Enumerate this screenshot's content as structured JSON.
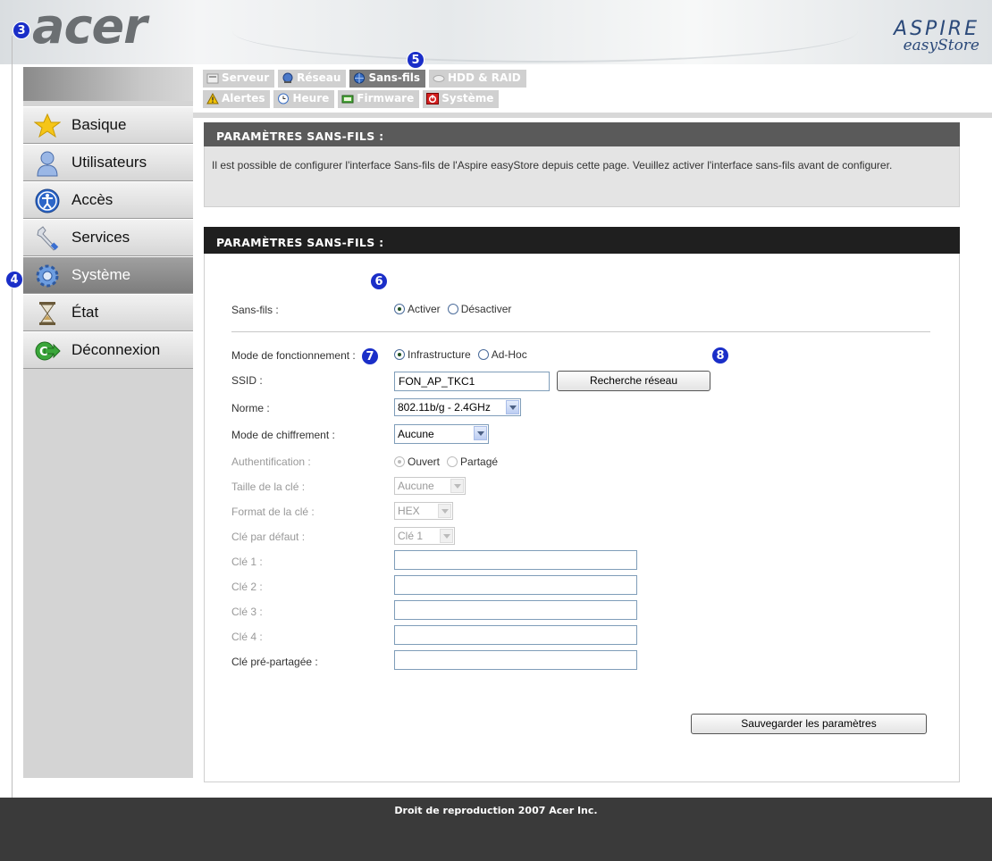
{
  "header": {
    "logo": "acer",
    "brand_line1": "ASPIRE",
    "brand_line2": "easyStore"
  },
  "badges": {
    "b3": "3",
    "b4": "4",
    "b5": "5",
    "b6": "6",
    "b7": "7",
    "b8": "8"
  },
  "sidebar": {
    "items": [
      {
        "label": "Basique",
        "icon": "star-icon"
      },
      {
        "label": "Utilisateurs",
        "icon": "user-icon"
      },
      {
        "label": "Accès",
        "icon": "accessibility-icon"
      },
      {
        "label": "Services",
        "icon": "wrench-icon"
      },
      {
        "label": "Système",
        "icon": "gear-icon",
        "active": true
      },
      {
        "label": "État",
        "icon": "hourglass-icon"
      },
      {
        "label": "Déconnexion",
        "icon": "logout-icon"
      }
    ]
  },
  "tabs": {
    "row1": [
      "Serveur",
      "Réseau",
      "Sans-fils",
      "HDD & RAID"
    ],
    "row2": [
      "Alertes",
      "Heure",
      "Firmware",
      "Système"
    ],
    "active": "Sans-fils"
  },
  "intro": {
    "title": "PARAMÈTRES SANS-FILS :",
    "text": "Il est possible de configurer l'interface Sans-fils de l'Aspire easyStore depuis cette page. Veuillez activer l'interface sans-fils avant de configurer."
  },
  "form": {
    "title": "PARAMÈTRES SANS-FILS :",
    "wireless_label": "Sans-fils :",
    "wireless_on": "Activer",
    "wireless_off": "Désactiver",
    "mode_label": "Mode de fonctionnement :",
    "mode_infra": "Infrastructure",
    "mode_adhoc": "Ad-Hoc",
    "ssid_label": "SSID :",
    "ssid_value": "FON_AP_TKC1",
    "scan_button": "Recherche réseau",
    "norm_label": "Norme :",
    "norm_value": "802.11b/g - 2.4GHz",
    "encryption_label": "Mode de chiffrement :",
    "encryption_value": "Aucune",
    "auth_label": "Authentification :",
    "auth_open": "Ouvert",
    "auth_shared": "Partagé",
    "keysize_label": "Taille de la clé :",
    "keysize_value": "Aucune",
    "keyformat_label": "Format de la clé :",
    "keyformat_value": "HEX",
    "defaultkey_label": "Clé par défaut :",
    "defaultkey_value": "Clé 1",
    "key1_label": "Clé 1 :",
    "key2_label": "Clé 2 :",
    "key3_label": "Clé 3 :",
    "key4_label": "Clé 4 :",
    "psk_label": "Clé pré-partagée :",
    "save_button": "Sauvegarder les paramètres"
  },
  "footer": {
    "copyright": "Droit de reproduction 2007 Acer Inc."
  }
}
